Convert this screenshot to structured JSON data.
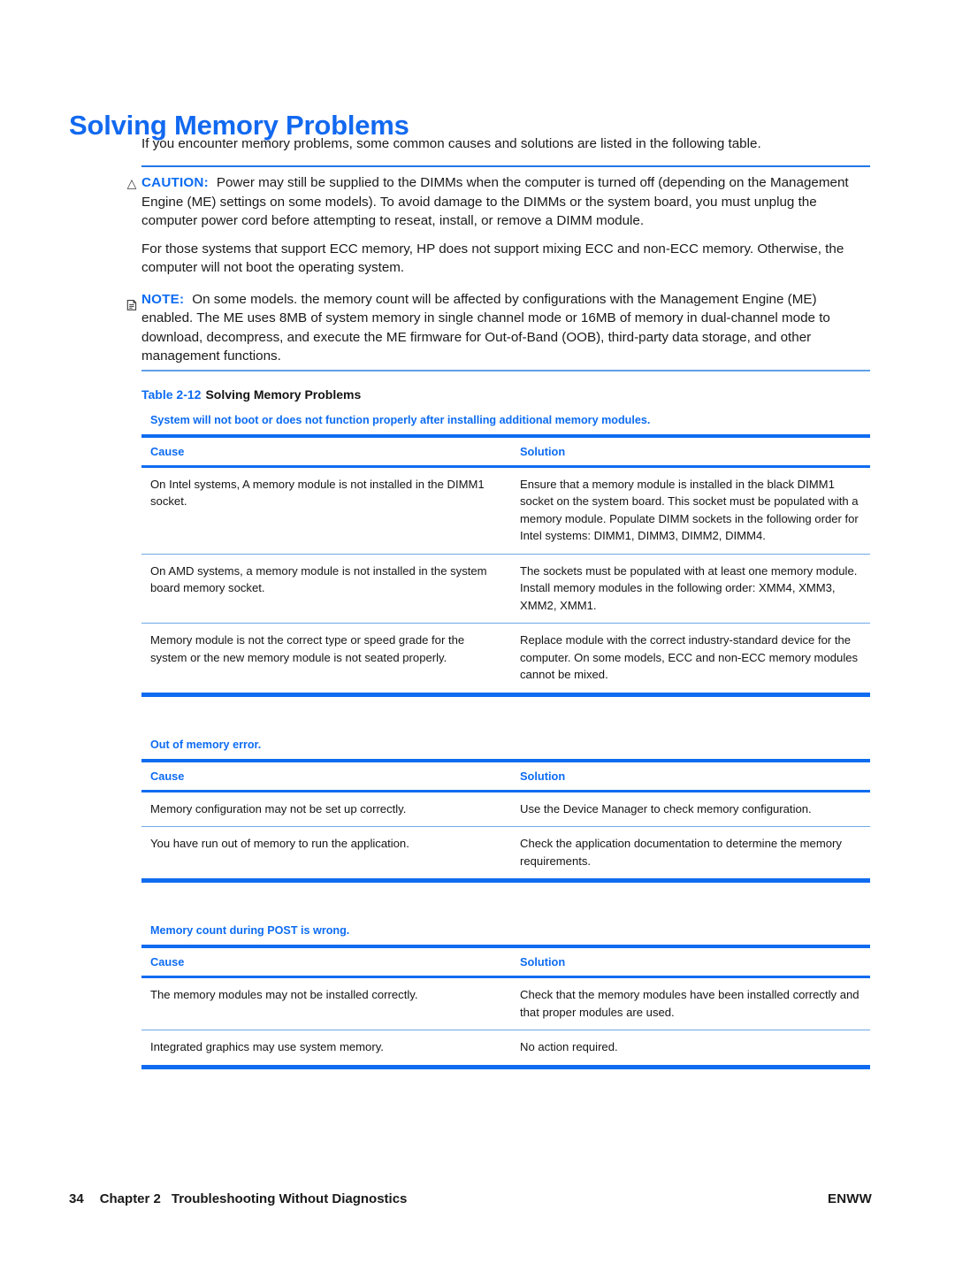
{
  "page": {
    "title": "Solving Memory Problems",
    "intro": "If you encounter memory problems, some common causes and solutions are listed in the following table."
  },
  "caution": {
    "icon": "warning-triangle-icon",
    "label": "CAUTION:",
    "text": "Power may still be supplied to the DIMMs when the computer is turned off (depending on the Management Engine (ME) settings on some models). To avoid damage to the DIMMs or the system board, you must unplug the computer power cord before attempting to reseat, install, or remove a DIMM module."
  },
  "ecc_paragraph": "For those systems that support ECC memory, HP does not support mixing ECC and non-ECC memory. Otherwise, the computer will not boot the operating system.",
  "note": {
    "icon": "note-icon",
    "label": "NOTE:",
    "text": "On some models. the memory count will be affected by configurations with the Management Engine (ME) enabled. The ME uses 8MB of system memory in single channel mode or 16MB of memory in dual-channel mode to download, decompress, and execute the ME firmware for Out-of-Band (OOB), third-party data storage, and other management functions."
  },
  "table_caption": {
    "number": "Table 2-12",
    "title": "Solving Memory Problems"
  },
  "columns": {
    "cause": "Cause",
    "solution": "Solution"
  },
  "sections": [
    {
      "subject": "System will not boot or does not function properly after installing additional memory modules.",
      "rows": [
        {
          "cause": "On Intel systems, A memory module is not installed in the DIMM1 socket.",
          "solution": "Ensure that a memory module is installed in the black DIMM1 socket on the system board. This socket must be populated with a memory module. Populate DIMM sockets in the following order for Intel systems: DIMM1, DIMM3, DIMM2, DIMM4."
        },
        {
          "cause": "On AMD systems, a memory module is not installed in the system board memory socket.",
          "solution": "The sockets must be populated with at least one memory module. Install memory modules in the following order: XMM4, XMM3, XMM2, XMM1."
        },
        {
          "cause": "Memory module is not the correct type or speed grade for the system or the new memory module is not seated properly.",
          "solution": "Replace module with the correct industry-standard device for the computer. On some models, ECC and non-ECC memory modules cannot be mixed."
        }
      ]
    },
    {
      "subject": "Out of memory error.",
      "rows": [
        {
          "cause": "Memory configuration may not be set up correctly.",
          "solution": "Use the Device Manager to check memory configuration."
        },
        {
          "cause": "You have run out of memory to run the application.",
          "solution": "Check the application documentation to determine the memory requirements."
        }
      ]
    },
    {
      "subject": "Memory count during POST is wrong.",
      "rows": [
        {
          "cause": "The memory modules may not be installed correctly.",
          "solution": "Check that the memory modules have been installed correctly and that proper modules are used."
        },
        {
          "cause": "Integrated graphics may use system memory.",
          "solution": "No action required."
        }
      ]
    }
  ],
  "footer": {
    "page_number": "34",
    "chapter": "Chapter 2",
    "chapter_title": "Troubleshooting Without Diagnostics",
    "imprint": "ENWW"
  },
  "colors": {
    "accent_blue": "#0d6cf2",
    "title_blue": "#1269f0",
    "rule_blue": "#0f6cf0",
    "thin_rule_blue": "#6ea8e6"
  }
}
